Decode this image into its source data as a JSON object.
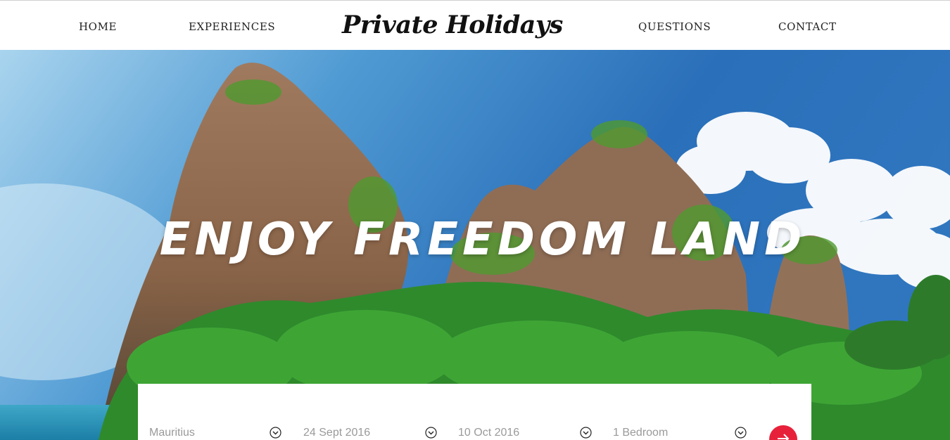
{
  "nav": {
    "home": "HOME",
    "experiences": "EXPERIENCES",
    "brand": "Private Holidays",
    "questions": "QUESTIONS",
    "contact": "CONTACT"
  },
  "hero": {
    "title": "ENJOY FREEDOM LAND"
  },
  "search": {
    "destination": "Mauritius",
    "check_in": "24 Sept 2016",
    "check_out": "10 Oct 2016",
    "rooms": "1 Bedroom"
  },
  "colors": {
    "accent": "#e8213b",
    "nav_text": "#222222",
    "field_text": "#9a9a9a"
  },
  "icons": {
    "dropdown": "chevron-down-circle-icon",
    "submit": "arrow-right-icon"
  }
}
